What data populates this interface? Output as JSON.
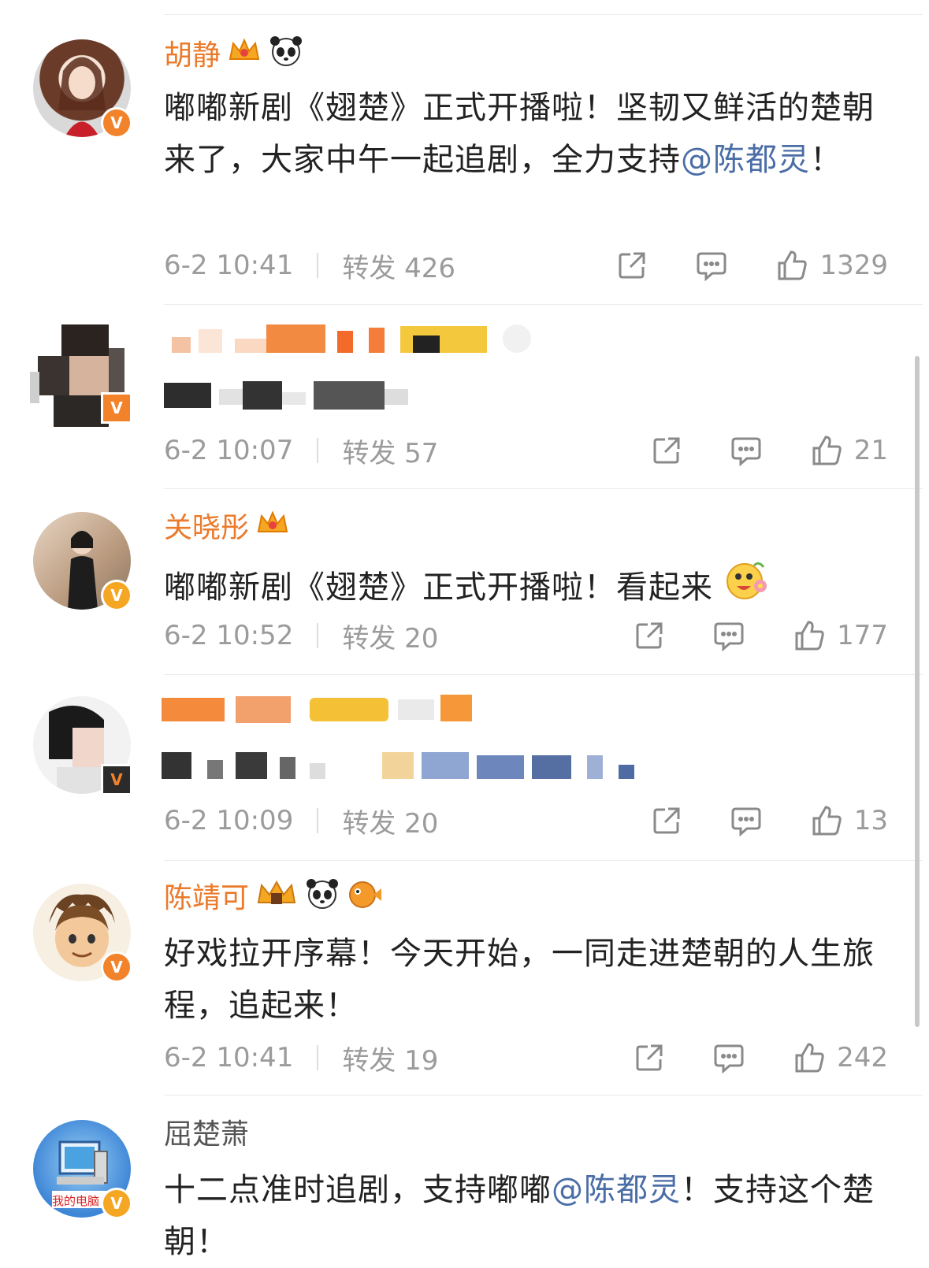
{
  "comments": [
    {
      "name": "胡静",
      "text_before": "嘟嘟新剧《翅楚》正式开播啦！坚韧又鲜活的楚朝来了，大家中午一起追剧，全力支持",
      "mention": "@陈都灵",
      "text_after": "！",
      "time": "6-2 10:41",
      "repost": "转发 426",
      "likes": "1329",
      "verified": "V",
      "badges": [
        "crown-icon",
        "panda-icon"
      ]
    },
    {
      "name": "",
      "text_before": "",
      "mention": "",
      "text_after": "",
      "time": "6-2 10:07",
      "repost": "转发 57",
      "likes": "21",
      "verified": "V",
      "blurred": true
    },
    {
      "name": "关晓彤",
      "text_before": "嘟嘟新剧《翅楚》正式开播啦！看起来",
      "mention": "",
      "text_after": "",
      "time": "6-2 10:52",
      "repost": "转发 20",
      "likes": "177",
      "verified": "V",
      "badges": [
        "crown-icon"
      ],
      "emoji": "flower-face-emoji"
    },
    {
      "name": "",
      "text_before": "",
      "mention": "",
      "text_after": "",
      "time": "6-2 10:09",
      "repost": "转发 20",
      "likes": "13",
      "verified": "V",
      "blurred": true
    },
    {
      "name": "陈靖可",
      "text_before": "好戏拉开序幕！今天开始，一同走进楚朝的人生旅程，追起来！",
      "mention": "",
      "text_after": "",
      "time": "6-2 10:41",
      "repost": "转发 19",
      "likes": "242",
      "verified": "V",
      "badges": [
        "crown-icon",
        "panda-icon",
        "fish-icon"
      ]
    },
    {
      "name": "屈楚萧",
      "text_before": "十二点准时追剧，支持嘟嘟",
      "mention": "@陈都灵",
      "text_after": "！支持这个楚朝！",
      "time": "",
      "repost": "",
      "likes": "",
      "verified": "V",
      "avatar_text": "我的电脑"
    }
  ],
  "colors": {
    "name": "#eb7a2b",
    "mention": "#4a6da6",
    "meta": "#9b9b9b",
    "badge": "#f2832b"
  }
}
